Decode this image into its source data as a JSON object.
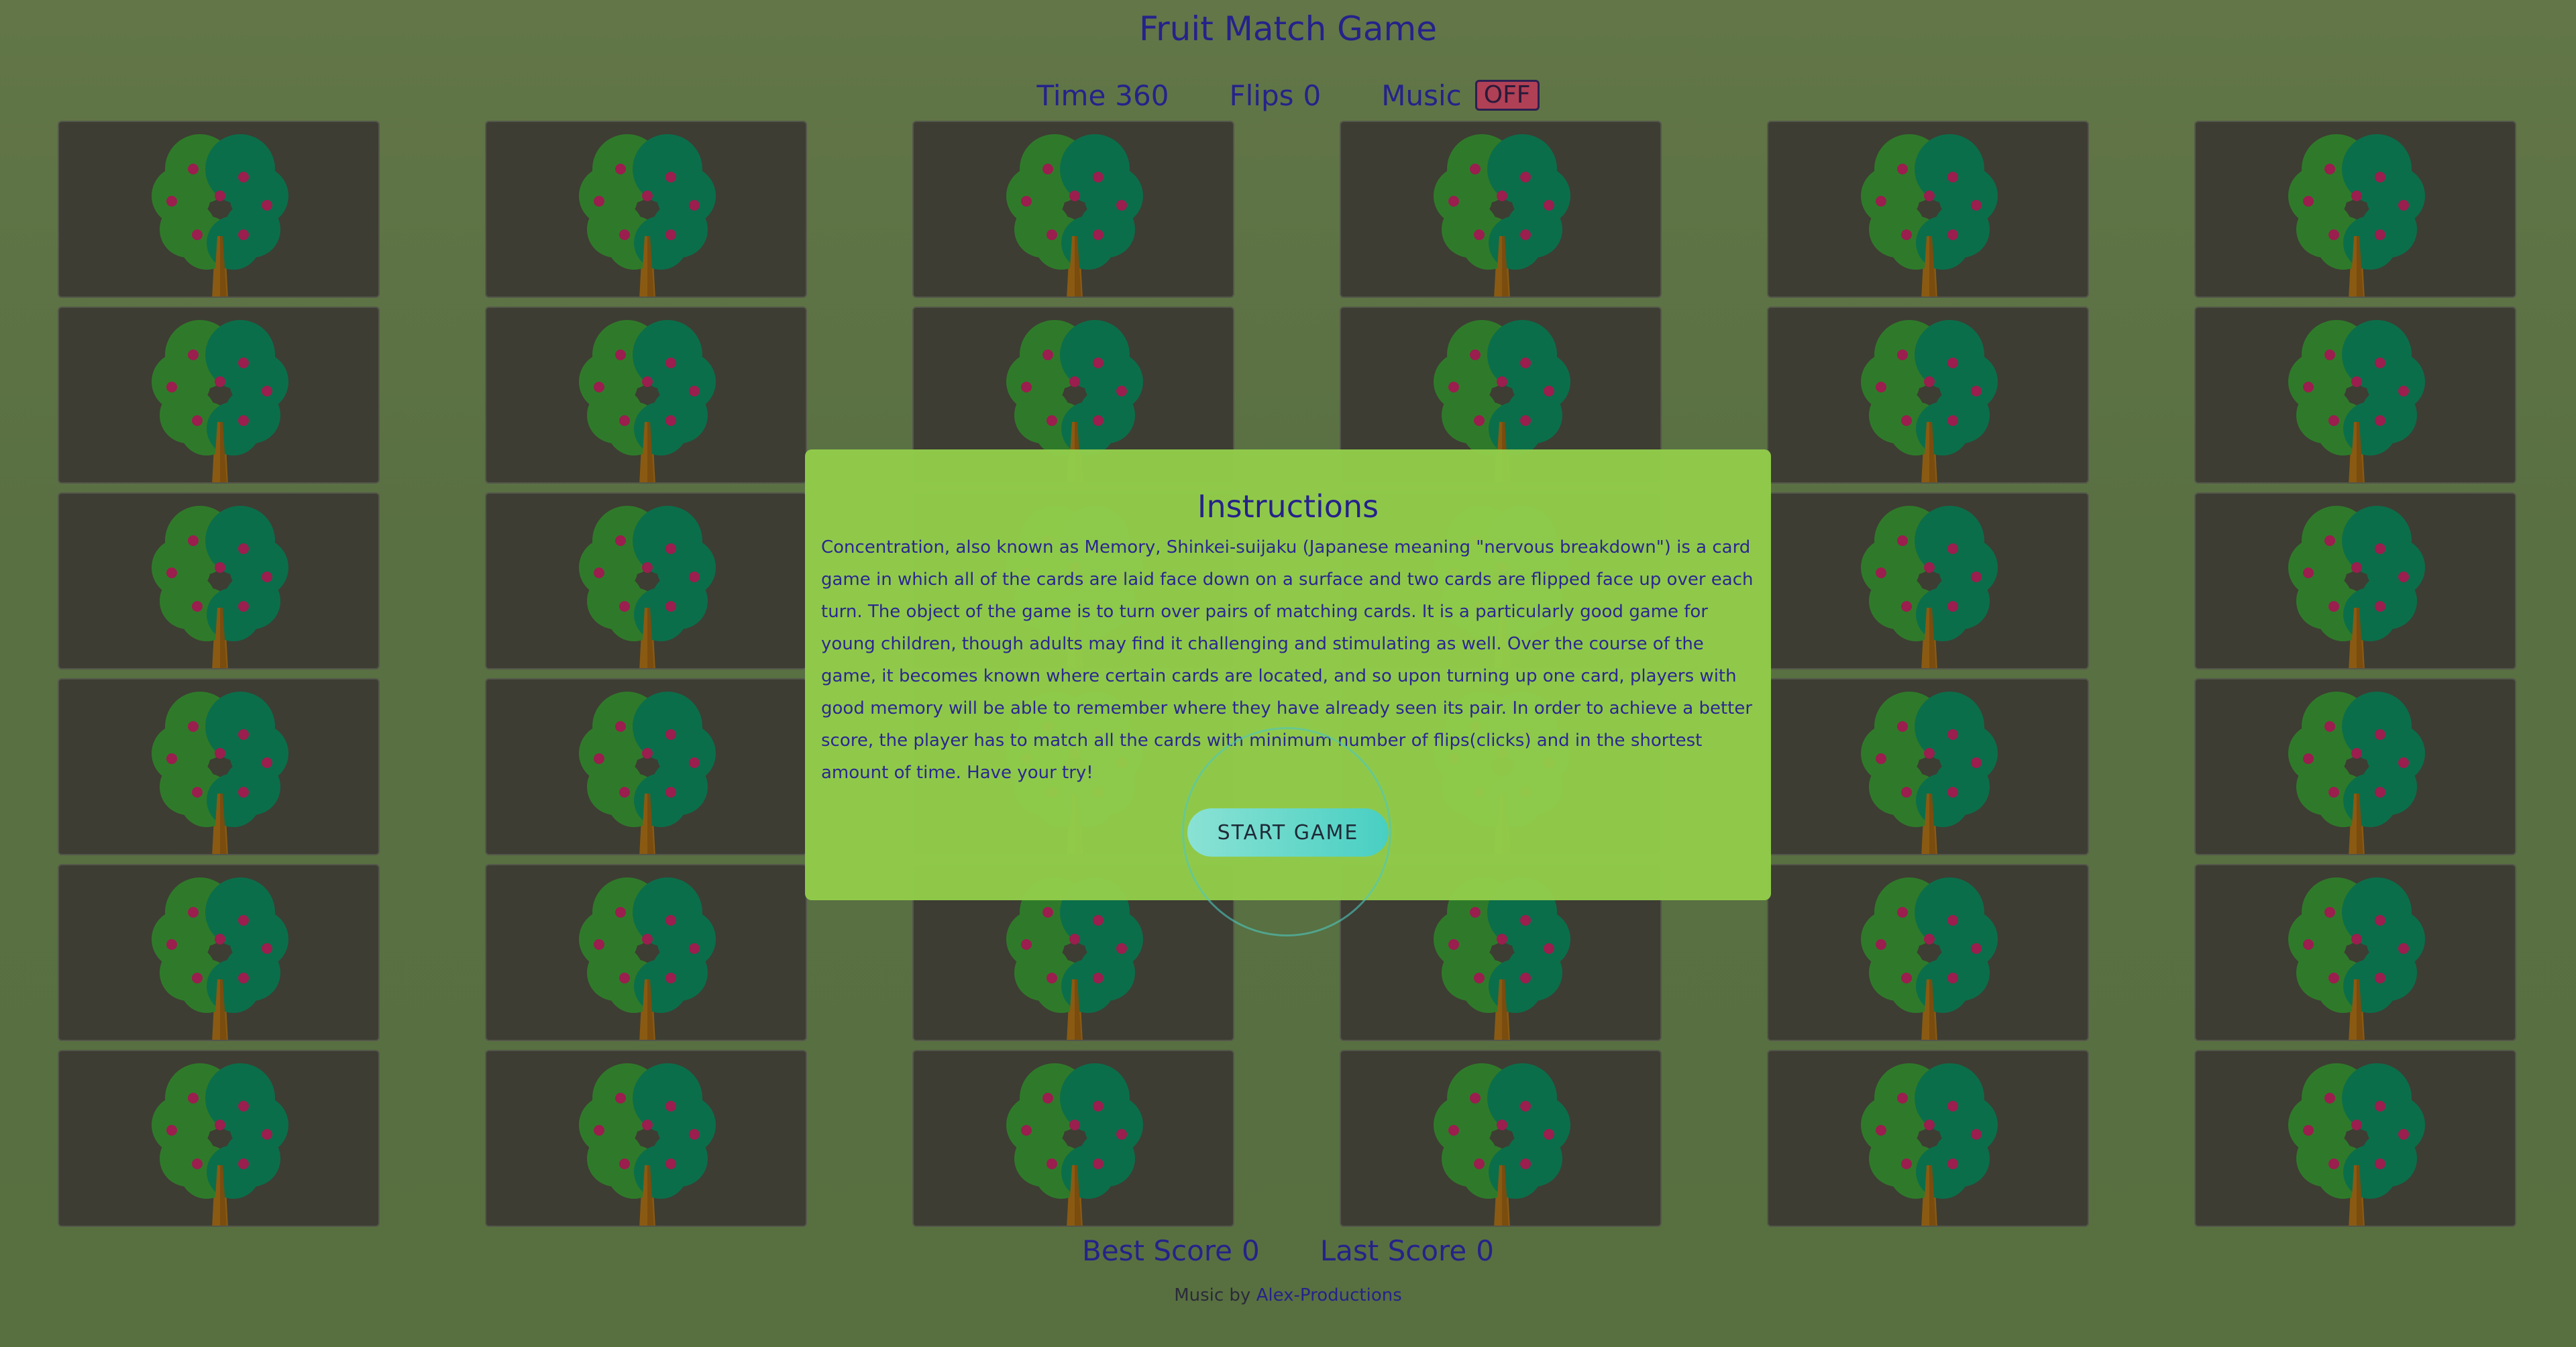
{
  "game": {
    "title": "Fruit Match Game"
  },
  "stats": {
    "time_label": "Time",
    "time_value": "360",
    "flips_label": "Flips",
    "flips_value": "0",
    "music_label": "Music",
    "music_state": "OFF"
  },
  "board": {
    "columns": 6,
    "rows": 6,
    "card_back_icon": "apple-tree-icon",
    "colors": {
      "card": "#3d3d33",
      "leaf_left": "#2f7a2a",
      "leaf_right": "#0b6e4a",
      "trunk": "#8a5a12",
      "fruit": "#9a1e4e"
    }
  },
  "instructions": {
    "title": "Instructions",
    "text": "Concentration, also known as Memory, Shinkei-suijaku (Japanese meaning \"nervous breakdown\") is a card game in which all of the cards are laid face down on a surface and two cards are flipped face up over each turn. The object of the game is to turn over pairs of matching cards. It is a particularly good game for young children, though adults may find it challenging and stimulating as well. Over the course of the game, it becomes known where certain cards are located, and so upon turning up one card, players with good memory will be able to remember where they have already seen its pair. In order to achieve a better score, the player has to match all the cards with minimum number of flips(clicks) and in the shortest amount of time. Have your try!",
    "start_label": "START GAME"
  },
  "scores": {
    "best_label": "Best Score",
    "best_value": "0",
    "last_label": "Last Score",
    "last_value": "0"
  },
  "credit": {
    "prefix": "Music by",
    "author": "Alex-Productions"
  }
}
